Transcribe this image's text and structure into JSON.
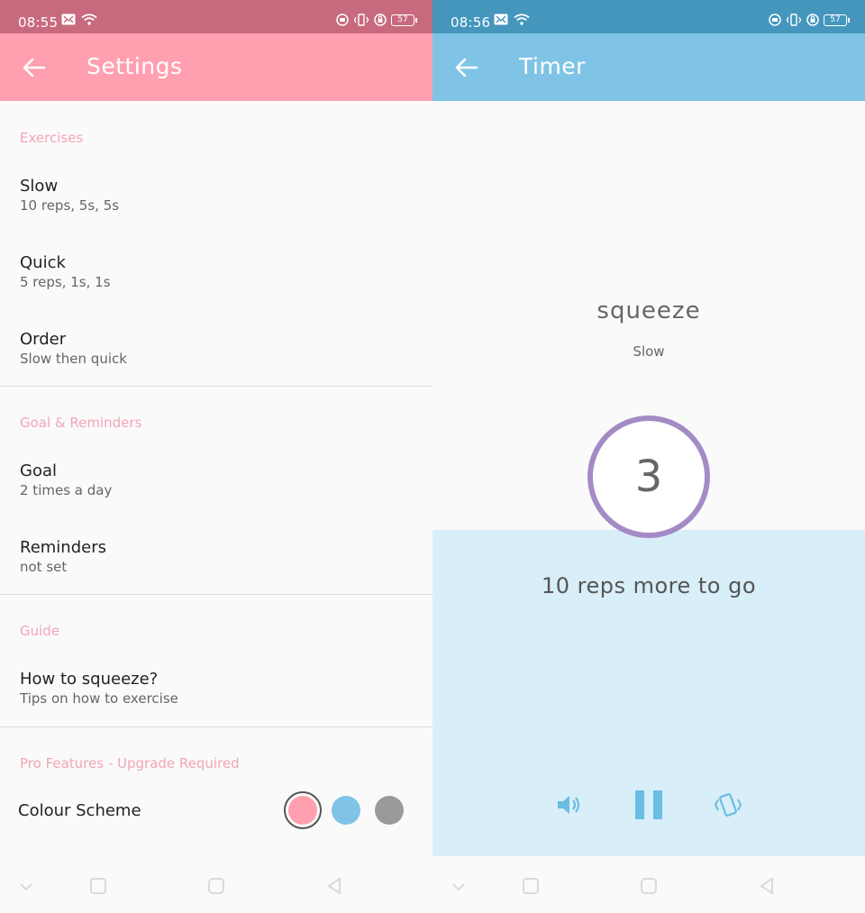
{
  "colors": {
    "settings_status_bar": "#c86a7d",
    "settings_app_bar": "#ff9fb0",
    "timer_status_bar": "#4596bd",
    "timer_app_bar": "#7fc4e6",
    "section_header": "#f3a5b6",
    "timer_panel": "#d8eef9",
    "counter_ring": "#a58bc6",
    "timer_controls": "#6bbde3"
  },
  "settings_screen": {
    "status_bar": {
      "time": "08:55",
      "battery": "57"
    },
    "app_bar": {
      "title": "Settings",
      "back_icon": "arrow-left-icon"
    },
    "sections": {
      "exercises": {
        "header": "Exercises",
        "items": [
          {
            "title": "Slow",
            "subtitle": "10 reps, 5s, 5s"
          },
          {
            "title": "Quick",
            "subtitle": "5 reps, 1s, 1s"
          },
          {
            "title": "Order",
            "subtitle": "Slow then quick"
          }
        ]
      },
      "goal": {
        "header": "Goal & Reminders",
        "items": [
          {
            "title": "Goal",
            "subtitle": "2 times a day"
          },
          {
            "title": "Reminders",
            "subtitle": "not set"
          }
        ]
      },
      "guide": {
        "header": "Guide",
        "items": [
          {
            "title": "How to squeeze?",
            "subtitle": "Tips on how to exercise"
          }
        ]
      },
      "pro": {
        "header": "Pro Features - Upgrade Required",
        "colour_scheme_label": "Colour Scheme",
        "swatches": [
          {
            "name": "pink",
            "color": "#ff9fb0",
            "selected": true
          },
          {
            "name": "blue",
            "color": "#7fc4e6",
            "selected": false
          },
          {
            "name": "grey",
            "color": "#9a9a9a",
            "selected": false
          }
        ]
      }
    }
  },
  "timer_screen": {
    "status_bar": {
      "time": "08:56",
      "battery": "57"
    },
    "app_bar": {
      "title": "Timer",
      "back_icon": "arrow-left-icon"
    },
    "instruction": "squeeze",
    "mode": "Slow",
    "counter": "3",
    "reps_remaining": "10 reps more to go",
    "controls": [
      "sound-icon",
      "pause-icon",
      "vibrate-icon"
    ]
  }
}
